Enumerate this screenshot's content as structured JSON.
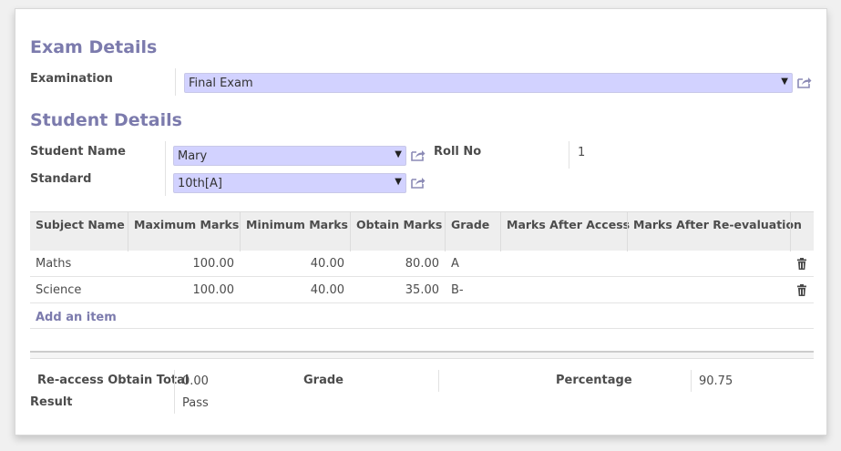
{
  "exam_section": {
    "title": "Exam Details",
    "examination_label": "Examination",
    "examination_value": "Final Exam"
  },
  "student_section": {
    "title": "Student Details",
    "student_name_label": "Student Name",
    "student_name_value": "Mary",
    "roll_no_label": "Roll No",
    "roll_no_value": "1",
    "standard_label": "Standard",
    "standard_value": "10th[A]"
  },
  "table": {
    "headers": [
      "Subject Name",
      "Maximum Marks",
      "Minimum Marks",
      "Obtain Marks",
      "Grade",
      "Marks After Access",
      "Marks After Re-evaluation"
    ],
    "rows": [
      {
        "subject": "Maths",
        "max": "100.00",
        "min": "40.00",
        "obtain": "80.00",
        "grade": "A",
        "after_access": "",
        "after_reeval": ""
      },
      {
        "subject": "Science",
        "max": "100.00",
        "min": "40.00",
        "obtain": "35.00",
        "grade": "B-",
        "after_access": "",
        "after_reeval": ""
      }
    ],
    "add_item": "Add an item"
  },
  "summary": {
    "reaccess_label": "Re-access Obtain Total",
    "reaccess_value": "0.00",
    "grade_label": "Grade",
    "grade_value": "",
    "percentage_label": "Percentage",
    "percentage_value": "90.75",
    "result_label": "Result",
    "result_value": "Pass"
  },
  "icons": {
    "external_link": "external-link-icon",
    "trash": "trash-icon",
    "caret": "caret-down-icon"
  },
  "colors": {
    "heading": "#7c7bad",
    "select_bg": "#d2d2ff",
    "table_header_bg": "#eeeeee"
  }
}
